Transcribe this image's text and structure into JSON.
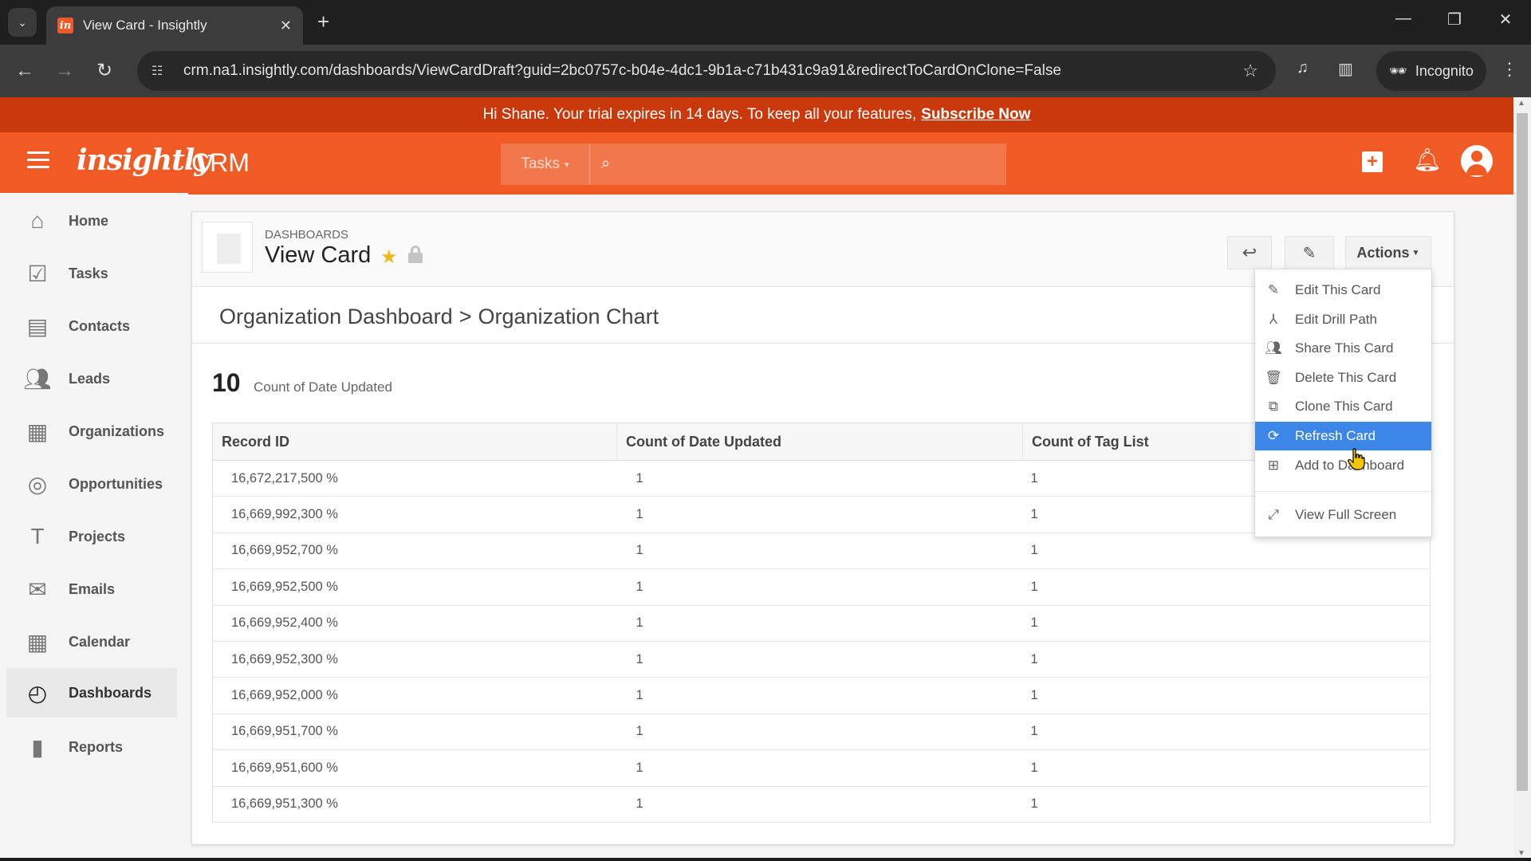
{
  "browser": {
    "tab_title": "View Card - Insightly",
    "tab_favicon": "in",
    "url": "crm.na1.insightly.com/dashboards/ViewCardDraft?guid=2bc0757c-b04e-4dc1-9b1a-c71b431c9a91&redirectToCardOnClone=False",
    "incognito_label": "Incognito",
    "icons": {
      "tab_list": "chevron-down-icon",
      "close_tab": "close-icon",
      "new_tab": "plus-icon",
      "back": "arrow-left-icon",
      "forward": "arrow-right-icon",
      "reload": "reload-icon",
      "bookmark": "star-outline-icon",
      "media": "media-control-icon",
      "side_panel": "side-panel-icon",
      "menu": "kebab-menu-icon"
    }
  },
  "banner": {
    "message": "Hi Shane. Your trial expires in 14 days. To keep all your features,",
    "link_label": "Subscribe Now"
  },
  "header": {
    "logo": "insightly",
    "product": "CRM",
    "search_scope": "Tasks",
    "search_placeholder": ""
  },
  "sidebar": {
    "items": [
      {
        "label": "Home",
        "icon": "home-icon",
        "active": false
      },
      {
        "label": "Tasks",
        "icon": "checkbox-icon",
        "active": false
      },
      {
        "label": "Contacts",
        "icon": "contact-card-icon",
        "active": false
      },
      {
        "label": "Leads",
        "icon": "people-icon",
        "active": false
      },
      {
        "label": "Organizations",
        "icon": "building-icon",
        "active": false
      },
      {
        "label": "Opportunities",
        "icon": "target-icon",
        "active": false
      },
      {
        "label": "Projects",
        "icon": "hammer-icon",
        "active": false
      },
      {
        "label": "Emails",
        "icon": "envelope-icon",
        "active": false
      },
      {
        "label": "Calendar",
        "icon": "calendar-icon",
        "active": false
      },
      {
        "label": "Dashboards",
        "icon": "gauge-icon",
        "active": true
      },
      {
        "label": "Reports",
        "icon": "bar-chart-icon",
        "active": false
      }
    ]
  },
  "card": {
    "kicker": "DASHBOARDS",
    "title": "View Card",
    "actions_label": "Actions",
    "breadcrumb": {
      "dashboard": "Organization Dashboard",
      "separator": ">",
      "card": "Organization Chart"
    },
    "metric": {
      "value": "10",
      "label": "Count of Date Updated"
    },
    "table": {
      "columns": [
        "Record ID",
        "Count of Date Updated",
        "Count of Tag List"
      ],
      "rows": [
        [
          "16,672,217,500 %",
          "1",
          "1"
        ],
        [
          "16,669,992,300 %",
          "1",
          "1"
        ],
        [
          "16,669,952,700 %",
          "1",
          "1"
        ],
        [
          "16,669,952,500 %",
          "1",
          "1"
        ],
        [
          "16,669,952,400 %",
          "1",
          "1"
        ],
        [
          "16,669,952,300 %",
          "1",
          "1"
        ],
        [
          "16,669,952,000 %",
          "1",
          "1"
        ],
        [
          "16,669,951,700 %",
          "1",
          "1"
        ],
        [
          "16,669,951,600 %",
          "1",
          "1"
        ],
        [
          "16,669,951,300 %",
          "1",
          "1"
        ]
      ]
    }
  },
  "actions_menu": {
    "items": [
      {
        "label": "Edit This Card",
        "icon": "pencil-icon"
      },
      {
        "label": "Edit Drill Path",
        "icon": "drill-path-icon"
      },
      {
        "label": "Share This Card",
        "icon": "share-users-icon"
      },
      {
        "label": "Delete This Card",
        "icon": "trash-icon"
      },
      {
        "label": "Clone This Card",
        "icon": "clone-icon"
      },
      {
        "label": "Refresh Card",
        "icon": "refresh-icon",
        "hover": true
      },
      {
        "label": "Add to Dashboard",
        "icon": "add-square-icon"
      },
      {
        "label": "View Full Screen",
        "icon": "fullscreen-icon"
      }
    ]
  },
  "colors": {
    "brand_orange": "#f05a24",
    "banner_red": "#c9390c",
    "menu_highlight": "#3b86e6",
    "favorite_star": "#f2b61a"
  }
}
